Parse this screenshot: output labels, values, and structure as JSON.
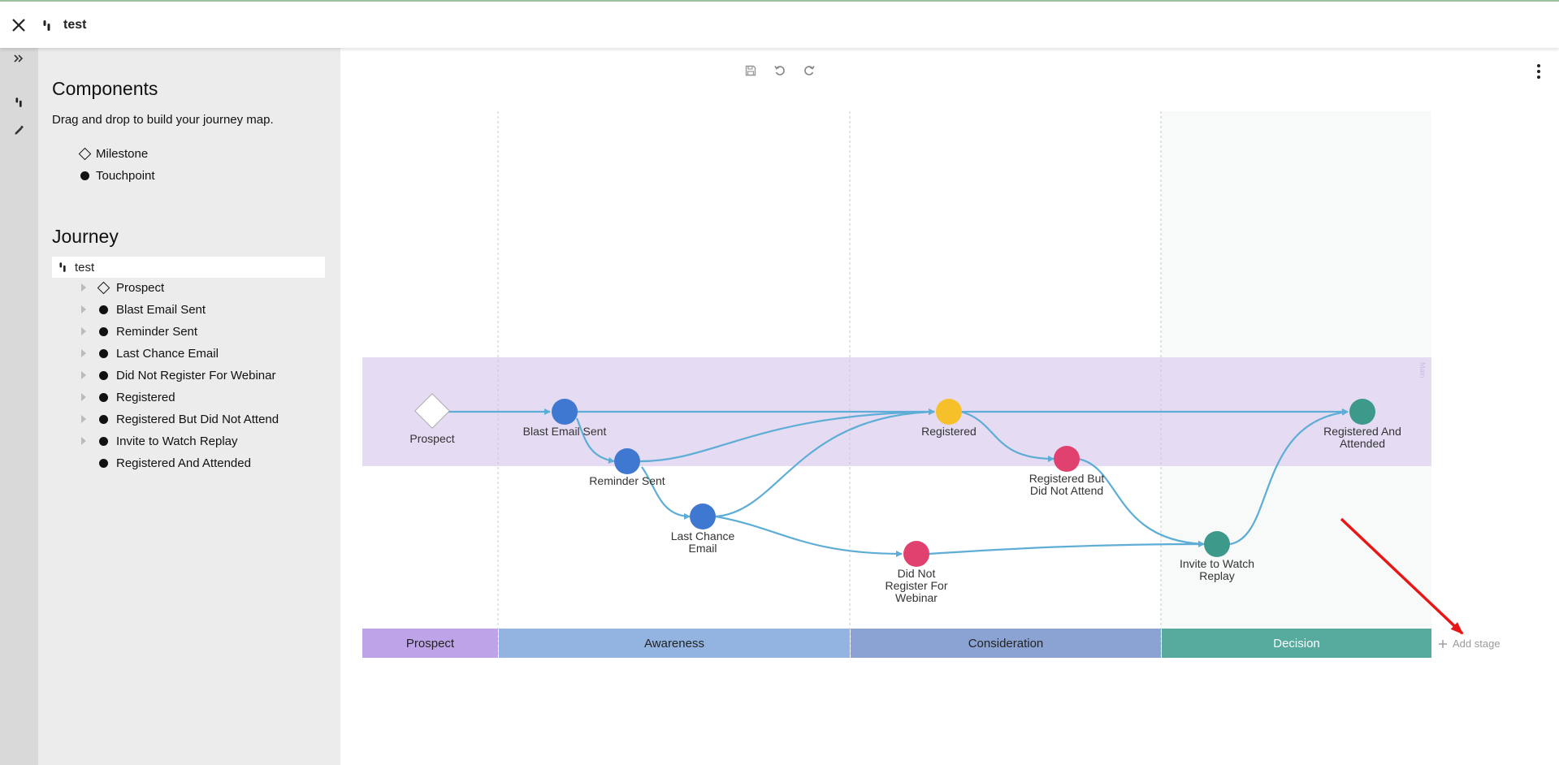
{
  "header": {
    "title": "test"
  },
  "components": {
    "title": "Components",
    "description": "Drag and drop to build your journey map.",
    "items": [
      {
        "label": "Milestone",
        "shape": "diamond"
      },
      {
        "label": "Touchpoint",
        "shape": "dot"
      }
    ]
  },
  "journey": {
    "title": "Journey",
    "root": "test",
    "items": [
      {
        "label": "Prospect",
        "shape": "diamond",
        "expandable": true
      },
      {
        "label": "Blast Email Sent",
        "shape": "dot",
        "expandable": true
      },
      {
        "label": "Reminder Sent",
        "shape": "dot",
        "expandable": true
      },
      {
        "label": "Last Chance Email",
        "shape": "dot",
        "expandable": true
      },
      {
        "label": "Did Not Register For Webinar",
        "shape": "dot",
        "expandable": true
      },
      {
        "label": "Registered",
        "shape": "dot",
        "expandable": true
      },
      {
        "label": "Registered But Did Not Attend",
        "shape": "dot",
        "expandable": true
      },
      {
        "label": "Invite to Watch Replay",
        "shape": "dot",
        "expandable": true
      },
      {
        "label": "Registered And Attended",
        "shape": "dot",
        "expandable": false
      }
    ]
  },
  "map": {
    "swimlane_label": "Main",
    "stages": [
      {
        "label": "Prospect",
        "color": "#bfa3e8",
        "text_color": "#222"
      },
      {
        "label": "Awareness",
        "color": "#93b4e0",
        "text_color": "#222"
      },
      {
        "label": "Consideration",
        "color": "#8aa3d2",
        "text_color": "#222"
      },
      {
        "label": "Decision",
        "color": "#56ab9e",
        "text_color": "#ffffff"
      }
    ],
    "add_stage_label": "Add stage",
    "nodes": {
      "prospect": {
        "label": "Prospect",
        "color": "#ffffff"
      },
      "blast": {
        "label": "Blast Email Sent",
        "color": "#3f78d0"
      },
      "reminder": {
        "label": "Reminder Sent",
        "color": "#3f78d0"
      },
      "lastchance": {
        "label1": "Last Chance",
        "label2": "Email",
        "color": "#3f78d0"
      },
      "didnot": {
        "label1": "Did Not",
        "label2": "Register For",
        "label3": "Webinar",
        "color": "#e0416f"
      },
      "registered": {
        "label": "Registered",
        "color": "#f5c02a"
      },
      "rbdna": {
        "label1": "Registered But",
        "label2": "Did Not Attend",
        "color": "#e0416f"
      },
      "invite": {
        "label1": "Invite to Watch",
        "label2": "Replay",
        "color": "#3d9a8b"
      },
      "attended": {
        "label1": "Registered And",
        "label2": "Attended",
        "color": "#3d9a8b"
      }
    },
    "edge_color": "#5eadd6",
    "lane_color": "#e5dcf3"
  }
}
